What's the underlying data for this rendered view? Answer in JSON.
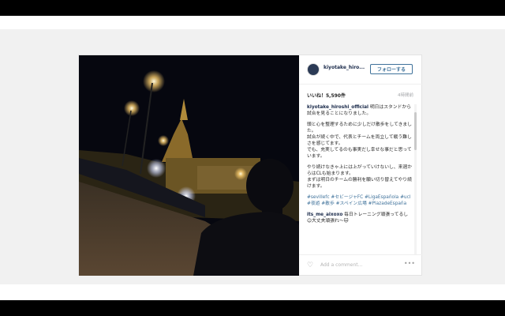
{
  "post": {
    "username": "kiyotake_hiro...",
    "follow_label": "フォローする",
    "likes": "いいね！5,590件",
    "time": "4時間前",
    "caption_user": "kiyotake_hiroshi_official",
    "caption_p1": "明日はスタンドから試合を見ることになりました。",
    "caption_p2": "頭と心を整理するために少しだけ散歩をしてきました。\n試合が続く中で、代表とチームを両立して戦う難しさを感じてます。\nでも、充実してるのも事実だし幸せな事だと思っています。",
    "caption_p3": "やり続けなきゃ上には上がっていけないし、来週からはCLも始まります。\nまずは明日のチームの勝利を願い切り替えてやり続けます。",
    "hashtags1": "#sevillefc #セビージャFC #LigaEspañola #ucl",
    "hashtags2": "#夜遊 #散歩 #スペイン広場 #PlazadeEspaña",
    "comment_user": "its_me_aixoxo",
    "comment_text": "毎日トレーニング頑張ってるし☺︎大丈夫頑張れ〜🐱",
    "add_comment_placeholder": "Add a comment...",
    "more": "•••"
  },
  "icons": {
    "heart": "heart-icon",
    "more": "more-options-icon"
  },
  "colors": {
    "link": "#3f729b",
    "bg_band": "#f1f1f1",
    "letterbox": "#000000"
  }
}
